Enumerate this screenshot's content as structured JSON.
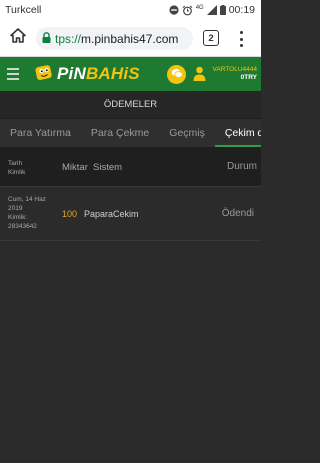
{
  "status_bar": {
    "carrier": "Turkcell",
    "network": "4G",
    "time": "00:19"
  },
  "browser": {
    "url_scheme": "tps://",
    "url_host": "m.pinbahis47.com",
    "tab_count": "2"
  },
  "site": {
    "logo_prefix": "PiN",
    "logo_suffix": "BAHiS",
    "username": "VARTOLU4444",
    "balance": "0TRY",
    "brand_green": "#1f7a31",
    "brand_yellow": "#f2c40f"
  },
  "page": {
    "title": "ÖDEMELER"
  },
  "tabs": [
    {
      "label": "Para Yatırma",
      "active": false
    },
    {
      "label": "Para Çekme",
      "active": false
    },
    {
      "label": "Geçmiş",
      "active": false
    },
    {
      "label": "Çekim du",
      "active": true
    }
  ],
  "table": {
    "headers": {
      "date_line1": "Tarih",
      "date_line2": "Kimlik",
      "amount": "Miktar",
      "system": "Sistem",
      "status": "Durum"
    },
    "rows": [
      {
        "date_line1": "Cum, 14 Haz",
        "date_line2": "2019",
        "id_label": "Kimlik:",
        "id_value": "28343642",
        "amount": "100",
        "system": "PaparaCekim",
        "status": "Ödendi"
      }
    ]
  }
}
